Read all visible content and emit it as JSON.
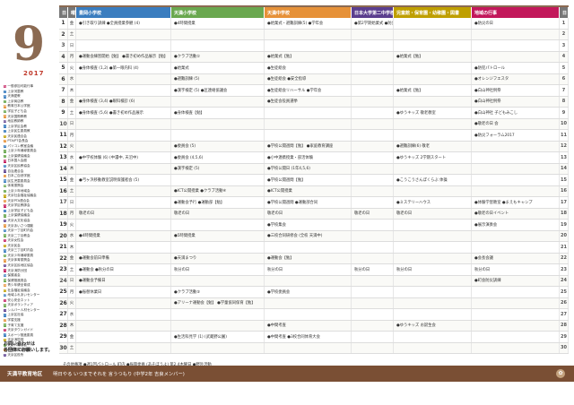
{
  "month": "9",
  "year": "2017",
  "legend": [
    {
      "badge": "般",
      "label": "一般参加可能行事",
      "color": "#c2185b"
    },
    {
      "badge": "上",
      "label": "上京河童教",
      "color": "#3a7dbf"
    },
    {
      "badge": "天",
      "label": "天満愛教",
      "color": "#3a7dbf"
    },
    {
      "badge": "上",
      "label": "上京商店教",
      "color": "#6aa84f"
    },
    {
      "badge": "教",
      "label": "教育日本公学館",
      "color": "#e69138"
    },
    {
      "badge": "学",
      "label": "学区子ども会",
      "color": "#6aa84f"
    },
    {
      "badge": "天",
      "label": "天京国際教教",
      "color": "#e69138"
    },
    {
      "badge": "地",
      "label": "地区教師教",
      "color": "#5b3e8e"
    },
    {
      "badge": "上",
      "label": "上京学区会教",
      "color": "#3a7dbf"
    },
    {
      "badge": "上",
      "label": "上京民生委員教",
      "color": "#3a7dbf"
    },
    {
      "badge": "天",
      "label": "天京民連合会",
      "color": "#bf9f00"
    },
    {
      "badge": "P",
      "label": "PTA/PT会長会",
      "color": "#e69138"
    },
    {
      "badge": "P",
      "label": "パソコン教室会議",
      "color": "#3a7dbf"
    },
    {
      "badge": "上",
      "label": "上京少年補導委員会",
      "color": "#6aa84f"
    },
    {
      "badge": "上",
      "label": "上京保健協議会",
      "color": "#6aa84f"
    },
    {
      "badge": "国",
      "label": "日本国人会館",
      "color": "#c2185b"
    },
    {
      "badge": "天",
      "label": "天京区民教協会",
      "color": "#3a7dbf"
    },
    {
      "badge": "自",
      "label": "自治連合会",
      "color": "#5b3e8e"
    },
    {
      "badge": "日",
      "label": "日本ご自然学館",
      "color": "#e69138"
    },
    {
      "badge": "民",
      "label": "民生児童委員会",
      "color": "#3a7dbf"
    },
    {
      "badge": "体",
      "label": "体育振興会",
      "color": "#6aa84f"
    },
    {
      "badge": "上",
      "label": "上京少年地域会",
      "color": "#6aa84f"
    },
    {
      "badge": "天",
      "label": "天京社会福祉協議会",
      "color": "#bf9f00"
    },
    {
      "badge": "天",
      "label": "天京PTA連合会",
      "color": "#e69138"
    },
    {
      "badge": "天",
      "label": "天京学区教師会",
      "color": "#c2185b"
    },
    {
      "badge": "上",
      "label": "上京学区子ども会",
      "color": "#3a7dbf"
    },
    {
      "badge": "上",
      "label": "上京保健協議会",
      "color": "#6aa84f"
    },
    {
      "badge": "天",
      "label": "天京大文化協会",
      "color": "#5b3e8e"
    },
    {
      "badge": "天",
      "label": "天京あいさつ運動",
      "color": "#e69138"
    },
    {
      "badge": "天",
      "label": "天京一丁目町内会",
      "color": "#3a7dbf"
    },
    {
      "badge": "天",
      "label": "天京二丁目教会",
      "color": "#6aa84f"
    },
    {
      "badge": "天",
      "label": "天京女性会",
      "color": "#c2185b"
    },
    {
      "badge": "天",
      "label": "天京民会",
      "color": "#bf9f00"
    },
    {
      "badge": "天",
      "label": "天京三丁目町内会",
      "color": "#3a7dbf"
    },
    {
      "badge": "天",
      "label": "天京少年補導委員",
      "color": "#6aa84f"
    },
    {
      "badge": "天",
      "label": "天京体育振興会",
      "color": "#e69138"
    },
    {
      "badge": "天",
      "label": "天京区民地区協会",
      "color": "#5b3e8e"
    },
    {
      "badge": "天",
      "label": "天京消防分団",
      "color": "#c2185b"
    },
    {
      "badge": "保",
      "label": "保護者会",
      "color": "#3a7dbf"
    },
    {
      "badge": "保",
      "label": "保健推進員会",
      "color": "#6aa84f"
    },
    {
      "badge": "青",
      "label": "青少年健全育成",
      "color": "#e69138"
    },
    {
      "badge": "社",
      "label": "社会福祉協議会",
      "color": "#bf9f00"
    },
    {
      "badge": "地",
      "label": "地域ふれあいセンター",
      "color": "#3a7dbf"
    },
    {
      "badge": "安",
      "label": "安心安全ネット",
      "color": "#c2185b"
    },
    {
      "badge": "天",
      "label": "天京ボランティア",
      "color": "#6aa84f"
    },
    {
      "badge": "シ",
      "label": "シルバー人材センター",
      "color": "#5b3e8e"
    },
    {
      "badge": "上",
      "label": "上京区社協",
      "color": "#3a7dbf"
    },
    {
      "badge": "学",
      "label": "学習支援",
      "color": "#e69138"
    },
    {
      "badge": "子",
      "label": "子育て支援",
      "color": "#6aa84f"
    },
    {
      "badge": "天",
      "label": "天京タウンガイド",
      "color": "#c2185b"
    },
    {
      "badge": "ス",
      "label": "スポーツ推進委員",
      "color": "#3a7dbf"
    },
    {
      "badge": "天",
      "label": "天京消防団",
      "color": "#bf9f00"
    },
    {
      "badge": "天",
      "label": "天京人権協会",
      "color": "#6aa84f"
    },
    {
      "badge": "地",
      "label": "地域教育協議会",
      "color": "#e69138"
    },
    {
      "badge": "天",
      "label": "天京区役所",
      "color": "#5b3e8e"
    }
  ],
  "contact_note": [
    "お問い合わせは",
    "各団体にお願いします。"
  ],
  "headers": {
    "day": "日",
    "weekday": "曜",
    "s1": "豊岡小学校",
    "s2": "天満小学校",
    "s3": "天満中学校",
    "s4": "日本大学第二中学校",
    "s5": "児童館・保育園・幼稚園・図書",
    "community": "地域の行事",
    "right": "日"
  },
  "rows": [
    {
      "d": "1",
      "w": "金",
      "s1": "●引き取り訓練 ●全員授業参観 (4)",
      "s2": "●4時間授業",
      "s3": "●始業式・避難訓練(5) ●学年会",
      "s4": "●第2学期始業式 ●防災訓練",
      "s5": "",
      "com": "●防災の日"
    },
    {
      "d": "2",
      "w": "土",
      "s1": "",
      "s2": "",
      "s3": "",
      "s4": "",
      "s5": "",
      "com": ""
    },
    {
      "d": "3",
      "w": "日",
      "s1": "",
      "s2": "",
      "s3": "",
      "s4": "",
      "s5": "",
      "com": ""
    },
    {
      "d": "4",
      "w": "月",
      "s1": "●運動会練習開始【勉】 ●書き初め作品展示【勉】",
      "s2": "●クラブ活動①",
      "s3": "●始業式【勉】",
      "s4": "",
      "s5": "●始業式【勉】",
      "com": ""
    },
    {
      "d": "5",
      "w": "火",
      "s1": "●身体検査 (1,2) ●第一眼内科 (4)",
      "s2": "●始業式",
      "s3": "●生徒総会",
      "s4": "",
      "s5": "",
      "com": "●防犯パトロール"
    },
    {
      "d": "6",
      "w": "水",
      "s1": "",
      "s2": "●避難訓練 (5)",
      "s3": "●生徒総会 ●安全指導",
      "s4": "",
      "s5": "",
      "com": "●オレンジフエスタ"
    },
    {
      "d": "7",
      "w": "木",
      "s1": "",
      "s2": "●漢字検定 (5) ●区連絡協議会",
      "s3": "●生徒総会リハーサル ●学年会",
      "s4": "",
      "s5": "●始業式【勉】",
      "com": "●白山神社例祭"
    },
    {
      "d": "8",
      "w": "金",
      "s1": "●身体検査 (3,4) ●眼科検診 (6)",
      "s2": "",
      "s3": "●生徒会役員選挙",
      "s4": "",
      "s5": "",
      "com": "●白山神社例祭"
    },
    {
      "d": "9",
      "w": "土",
      "s1": "●身体検査 (5,6) ●書き初め作品展示",
      "s2": "●身体検査【勉】",
      "s3": "",
      "s4": "",
      "s5": "●ゆうキッズ 敬老教室",
      "com": "●白山神社 子どもみこし"
    },
    {
      "d": "10",
      "w": "日",
      "s1": "",
      "s2": "",
      "s3": "",
      "s4": "",
      "s5": "",
      "com": "●敬老の日 会"
    },
    {
      "d": "11",
      "w": "月",
      "s1": "",
      "s2": "",
      "s3": "",
      "s4": "",
      "s5": "",
      "com": "●防災フォーラム2017"
    },
    {
      "d": "12",
      "w": "火",
      "s1": "",
      "s2": "●委員会 (5)",
      "s3": "●学校公開週間【勉】 ●家庭教育講座",
      "s4": "",
      "s5": "●避難訓練(6) 敬老",
      "com": ""
    },
    {
      "d": "13",
      "w": "水",
      "s1": "●中学校体験 (6) (中濃中, 天沼中)",
      "s2": "●委員会 (4,5,6)",
      "s3": "●小中連携授業・部活体験",
      "s4": "",
      "s5": "●ゆうキッズ 2学期スタート",
      "com": ""
    },
    {
      "d": "14",
      "w": "木",
      "s1": "",
      "s2": "●漢字検定 (5)",
      "s3": "●学校公開日 (1年4,5,6)",
      "s4": "",
      "s5": "",
      "com": ""
    },
    {
      "d": "15",
      "w": "金",
      "s1": "●弓ヶ浜移動教室説明保護者会 (5)",
      "s2": "",
      "s3": "●学校公開週間【勉】",
      "s4": "",
      "s5": "●こうこうさんぽくらぶ 体操",
      "com": ""
    },
    {
      "d": "16",
      "w": "土",
      "s1": "",
      "s2": "●ICT公開授業 ●クラブ活動④",
      "s3": "●ICT公開授業",
      "s4": "",
      "s5": "",
      "com": ""
    },
    {
      "d": "17",
      "w": "日",
      "s1": "",
      "s2": "●運動会予行 ●運動部【勉】",
      "s3": "●学校公開週間 ●運動部合同",
      "s4": "",
      "s5": "●ミステリーハウス",
      "com": "●体験学習教室 ●まえもキャンプ"
    },
    {
      "d": "18",
      "w": "月",
      "s1": "敬老の日",
      "s2": "敬老の日",
      "s3": "敬老の日",
      "s4": "敬老の日",
      "s5": "敬老の日",
      "com": "●敬老の日イベント"
    },
    {
      "d": "19",
      "w": "火",
      "s1": "",
      "s2": "",
      "s3": "●学校集会",
      "s4": "",
      "s5": "",
      "com": "●展示演奏会"
    },
    {
      "d": "20",
      "w": "水",
      "s1": "●4時間授業",
      "s2": "●5時間授業",
      "s3": "●三校合同研修会 (全校 天満中)",
      "s4": "",
      "s5": "",
      "com": ""
    },
    {
      "d": "21",
      "w": "木",
      "s1": "",
      "s2": "",
      "s3": "",
      "s4": "",
      "s5": "",
      "com": ""
    },
    {
      "d": "22",
      "w": "金",
      "s1": "●運動会前日準備",
      "s2": "●天満まつり",
      "s3": "●運動会【勉】",
      "s4": "",
      "s5": "",
      "com": "●会長会議"
    },
    {
      "d": "23",
      "w": "土",
      "s1": "●運動会 ●秋分の日",
      "s2": "秋分の日",
      "s3": "秋分の日",
      "s4": "秋分の日",
      "s5": "秋分の日",
      "com": "秋分の日"
    },
    {
      "d": "24",
      "w": "日",
      "s1": "●運動会予備日",
      "s2": "",
      "s3": "",
      "s4": "",
      "s5": "",
      "com": "●町会防災訓練"
    },
    {
      "d": "25",
      "w": "月",
      "s1": "●振替休業日",
      "s2": "●クラブ活動⑤",
      "s3": "●学校委員会",
      "s4": "",
      "s5": "",
      "com": ""
    },
    {
      "d": "26",
      "w": "火",
      "s1": "",
      "s2": "●アリーナ運動会【勉】 ●学童協同保育【勉】",
      "s3": "",
      "s4": "",
      "s5": "",
      "com": ""
    },
    {
      "d": "27",
      "w": "水",
      "s1": "",
      "s2": "",
      "s3": "",
      "s4": "",
      "s5": "",
      "com": ""
    },
    {
      "d": "28",
      "w": "木",
      "s1": "",
      "s2": "",
      "s3": "●中間考査",
      "s4": "",
      "s5": "●ゆうキッズ お誕生会",
      "com": ""
    },
    {
      "d": "29",
      "w": "金",
      "s1": "",
      "s2": "●生活科見学 (1) (武蔵野公園)",
      "s3": "●中間考査 ●3校合同体育大会",
      "s4": "",
      "s5": "",
      "com": ""
    },
    {
      "d": "30",
      "w": "土",
      "s1": "",
      "s2": "",
      "s3": "",
      "s4": "",
      "s5": "",
      "com": ""
    }
  ],
  "other_events": "その他事項 ●週1回パトロール 町内 ●振興委員 (あそぼうよ) 第2,4木曜日 ●野外活動",
  "footer": {
    "title": "天満平教育地区",
    "motto": "明日やる いつまでそれを 言うつもり (中学2年 吉良メンバー)"
  }
}
